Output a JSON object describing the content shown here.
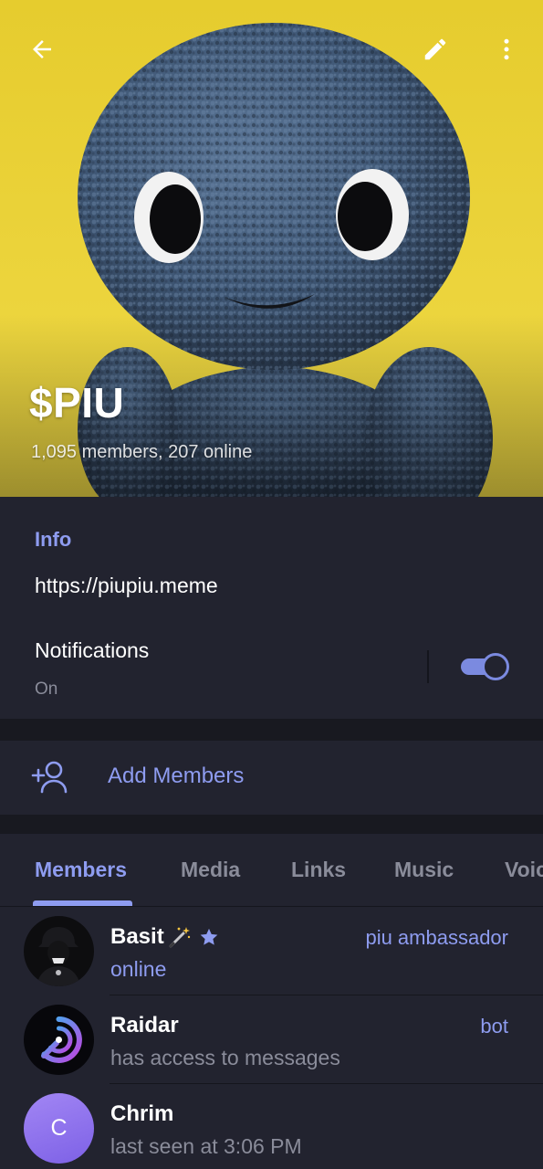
{
  "header": {
    "title": "$PIU",
    "subtitle": "1,095 members, 207 online",
    "colors": {
      "background": "#ecd43a",
      "mascot": "#3f5775"
    },
    "icons": {
      "back": "arrow-back-icon",
      "edit": "pencil-icon",
      "more": "more-vertical-icon"
    }
  },
  "info": {
    "heading": "Info",
    "link": "https://piupiu.meme",
    "notifications_label": "Notifications",
    "notifications_value": "On",
    "notifications_enabled": true
  },
  "add_members": {
    "label": "Add Members",
    "icon": "add-person-icon"
  },
  "tabs": [
    {
      "label": "Members",
      "active": true
    },
    {
      "label": "Media",
      "active": false
    },
    {
      "label": "Links",
      "active": false
    },
    {
      "label": "Music",
      "active": false
    },
    {
      "label": "Voic",
      "active": false
    }
  ],
  "members": [
    {
      "name": "Basit",
      "status": "online",
      "role": "piu ambassador",
      "avatar": "hooded-figure-avatar",
      "emoji_status": "magic-wand-icon",
      "badge": "star-icon"
    },
    {
      "name": "Raidar",
      "status": "has access to messages",
      "role": "bot",
      "avatar": "radar-logo-avatar"
    },
    {
      "name": "Chrim",
      "status": "last seen at 3:06 PM",
      "role": "",
      "avatar_letter": "C"
    }
  ],
  "colors": {
    "accent": "#8e9cf0",
    "background": "#22232f",
    "divider": "#181920",
    "muted_text": "#8a8c9a"
  }
}
